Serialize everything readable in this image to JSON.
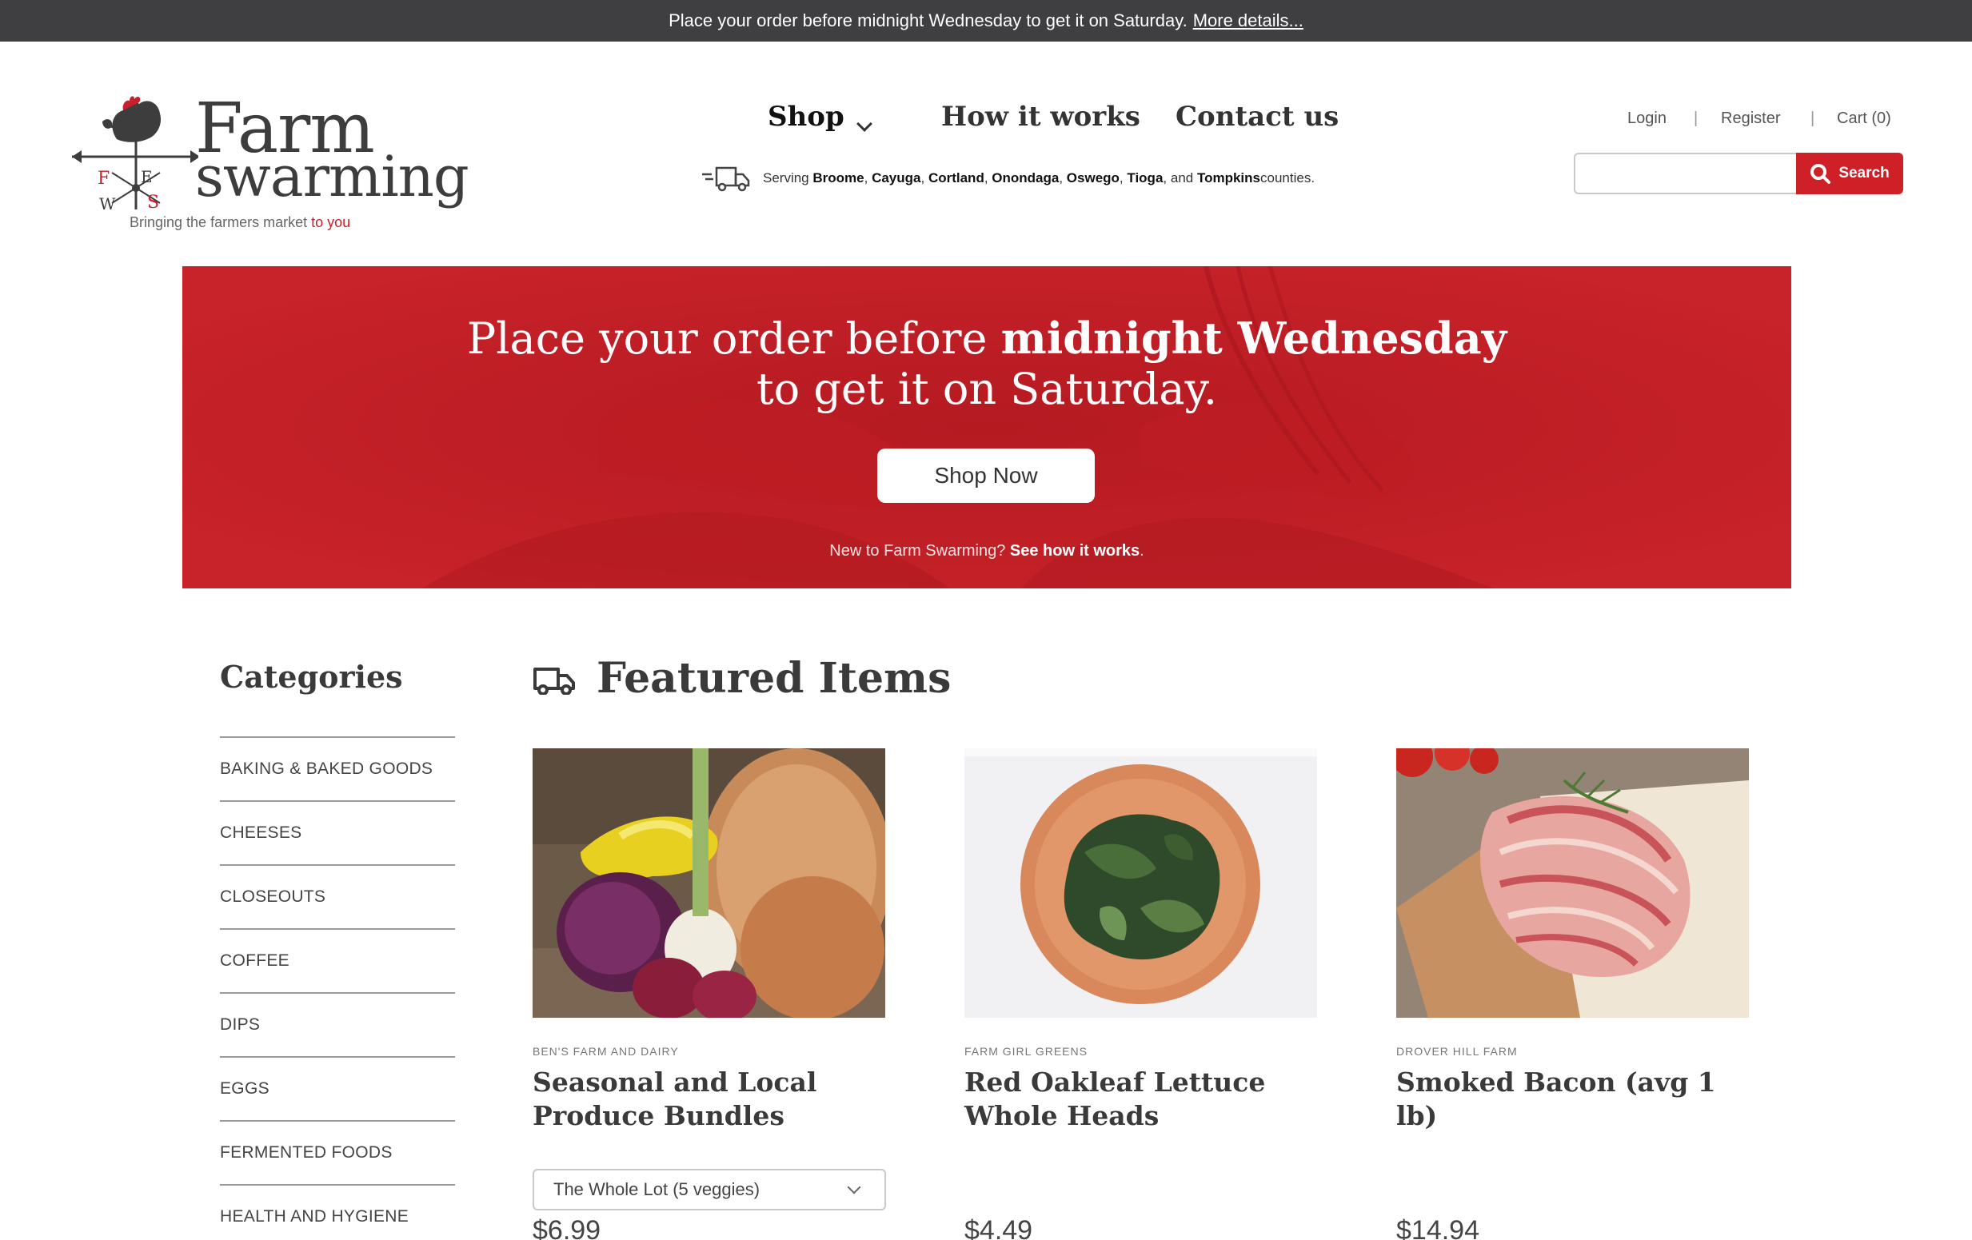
{
  "announcement": {
    "text": "Place your order before midnight Wednesday to get it on Saturday.",
    "link": "More details..."
  },
  "logo": {
    "word1": "Farm",
    "word2": "swarming",
    "tagline_prefix": "Bringing the farmers market ",
    "tagline_highlight": "to you",
    "vane_letters": [
      "F",
      "E",
      "W",
      "S"
    ]
  },
  "nav": {
    "shop": "Shop",
    "how": "How it works",
    "contact": "Contact us"
  },
  "serving": {
    "prefix": "Serving ",
    "c1": "Broome",
    "c2": "Cayuga",
    "c3": "Cortland",
    "c4": "Onondaga",
    "c5": "Oswego",
    "c6": "Tioga",
    "and": "and",
    "c7": "Tompkins",
    "suffix": " counties."
  },
  "account": {
    "login": "Login",
    "sep": "|",
    "register": "Register",
    "cart": "Cart (0)"
  },
  "search": {
    "placeholder": "",
    "button": "Search"
  },
  "hero": {
    "line1_regular": "Place your order before ",
    "line1_bold": "midnight Wednesday",
    "line2": "to get it on Saturday.",
    "button": "Shop Now",
    "new_prefix": "New to Farm Swarming? ",
    "new_link": "See how it works",
    "new_suffix": "."
  },
  "categories": {
    "title": "Categories",
    "items": [
      "BAKING & BAKED GOODS",
      "CHEESES",
      "CLOSEOUTS",
      "COFFEE",
      "DIPS",
      "EGGS",
      "FERMENTED FOODS",
      "HEALTH AND HYGIENE"
    ]
  },
  "featured": {
    "title": "Featured Items",
    "items": [
      {
        "vendor": "BEN'S FARM AND DAIRY",
        "name": "Seasonal and Local Produce Bundles",
        "option": "The Whole Lot (5 veggies)",
        "price": "$6.99"
      },
      {
        "vendor": "FARM GIRL GREENS",
        "name": "Red Oakleaf Lettuce Whole Heads",
        "price": "$4.49"
      },
      {
        "vendor": "DROVER HILL FARM",
        "name": "Smoked Bacon (avg 1 lb)",
        "price": "$14.94"
      }
    ]
  },
  "colors": {
    "brand_red": "#c61f26",
    "announce_bg": "#3f3f42",
    "text_dark": "#3a3a3a"
  }
}
